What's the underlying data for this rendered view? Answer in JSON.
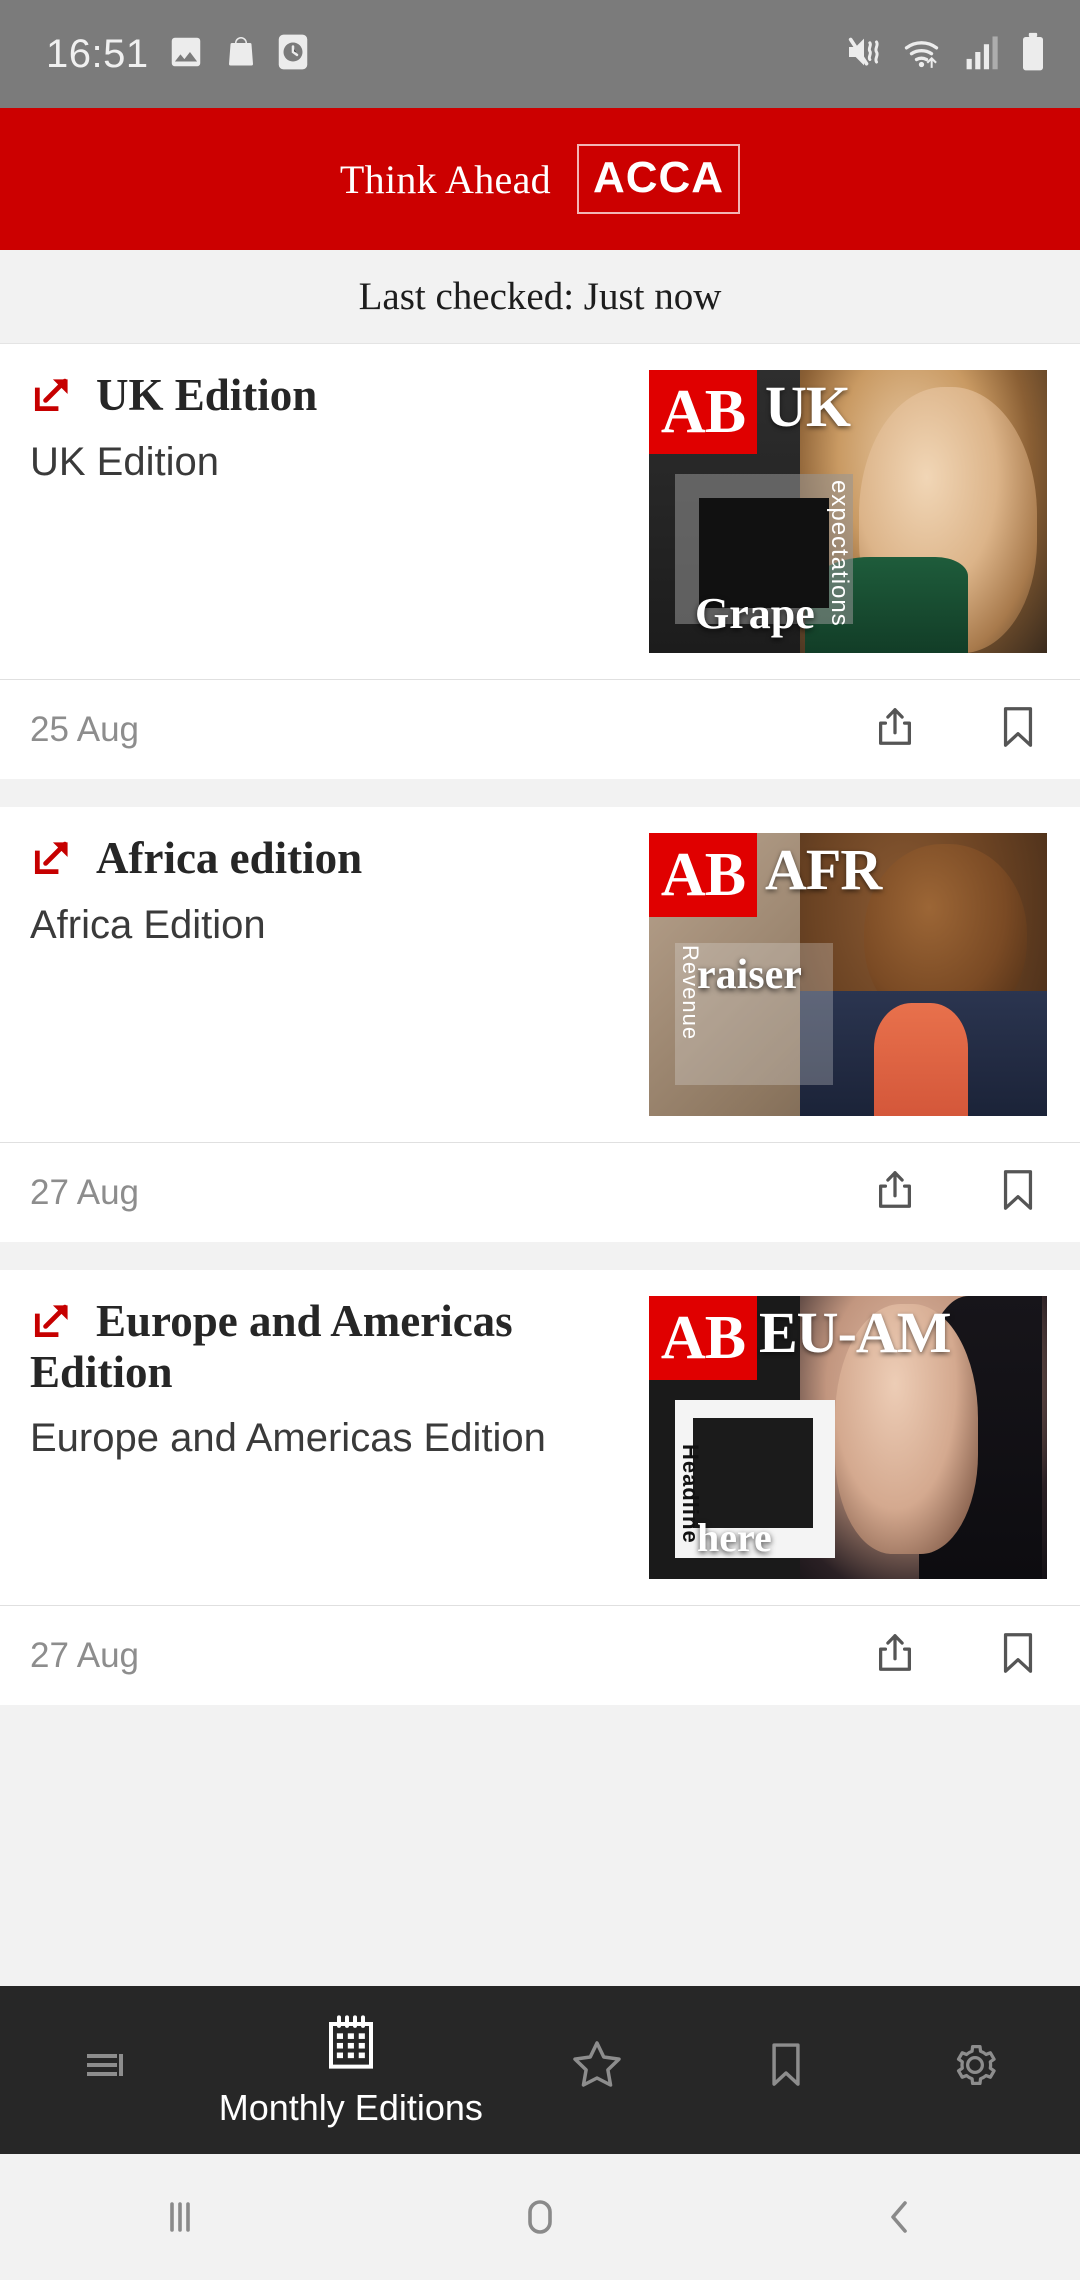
{
  "status_bar": {
    "clock": "16:51",
    "left_icons": [
      "image-icon",
      "shopping-bag-icon",
      "clock-app-icon"
    ],
    "right_icons": [
      "mute-vibrate-icon",
      "wifi-icon",
      "signal-bars-icon",
      "battery-icon"
    ]
  },
  "header": {
    "tagline": "Think Ahead",
    "logo": "ACCA",
    "background_color": "#cc0000"
  },
  "sync_bar": {
    "text": "Last checked: Just now"
  },
  "editions": [
    {
      "title": "UK Edition",
      "subtitle": "UK Edition",
      "date": "25 Aug",
      "link_icon": "external-link-icon",
      "share_icon": "share-icon",
      "bookmark_icon": "bookmark-icon",
      "thumbnail": {
        "badge": "AB",
        "region": "UK",
        "headline": "Grape",
        "vertical_text": "expectations",
        "badge_color": "#e00000",
        "background_color": "#252525"
      }
    },
    {
      "title": "Africa edition",
      "subtitle": "Africa Edition",
      "date": "27 Aug",
      "link_icon": "external-link-icon",
      "share_icon": "share-icon",
      "bookmark_icon": "bookmark-icon",
      "thumbnail": {
        "badge": "AB",
        "region": "AFR",
        "headline": "raiser",
        "vertical_text": "Revenue",
        "badge_color": "#e00000",
        "background_color": "#8a7a6c"
      }
    },
    {
      "title": "Europe and Americas Edition",
      "subtitle": "Europe and Americas Edition",
      "date": "27 Aug",
      "link_icon": "external-link-icon",
      "share_icon": "share-icon",
      "bookmark_icon": "bookmark-icon",
      "thumbnail": {
        "badge": "AB",
        "region": "EU-AM",
        "headline": "here",
        "vertical_text": "Headline",
        "badge_color": "#e00000",
        "background_color": "#1a1a1a"
      }
    }
  ],
  "tab_bar": {
    "background_color": "#272727",
    "items": [
      {
        "icon": "feed-list-icon",
        "label": "",
        "active": false
      },
      {
        "icon": "calendar-icon",
        "label": "Monthly Editions",
        "active": true
      },
      {
        "icon": "star-icon",
        "label": "",
        "active": false
      },
      {
        "icon": "bookmark-icon",
        "label": "",
        "active": false
      },
      {
        "icon": "gear-icon",
        "label": "",
        "active": false
      }
    ]
  },
  "android_nav": {
    "recents_icon": "recents-icon",
    "home_icon": "home-icon",
    "back_icon": "back-icon"
  }
}
